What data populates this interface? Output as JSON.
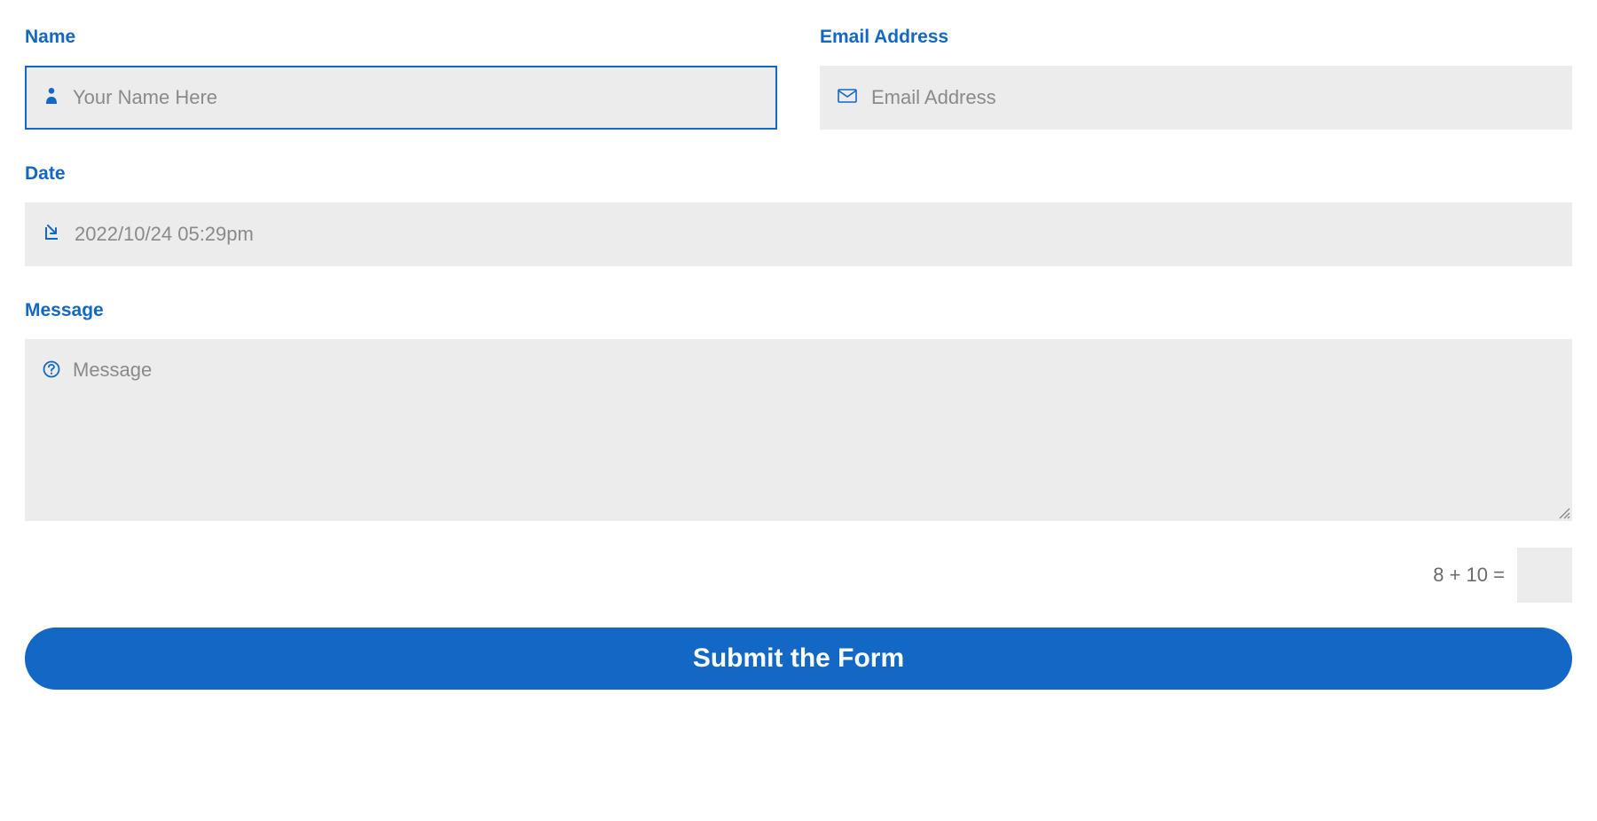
{
  "colors": {
    "accent": "#1268c4",
    "fieldBg": "#ececec",
    "placeholder": "#8a8a8a"
  },
  "form": {
    "name": {
      "label": "Name",
      "placeholder": "Your Name Here",
      "value": ""
    },
    "email": {
      "label": "Email Address",
      "placeholder": "Email Address",
      "value": ""
    },
    "date": {
      "label": "Date",
      "placeholder": "2022/10/24 05:29pm",
      "value": ""
    },
    "message": {
      "label": "Message",
      "placeholder": "Message",
      "value": ""
    },
    "captcha": {
      "question": "8 + 10 =",
      "value": ""
    },
    "submit": {
      "label": "Submit the Form"
    }
  }
}
